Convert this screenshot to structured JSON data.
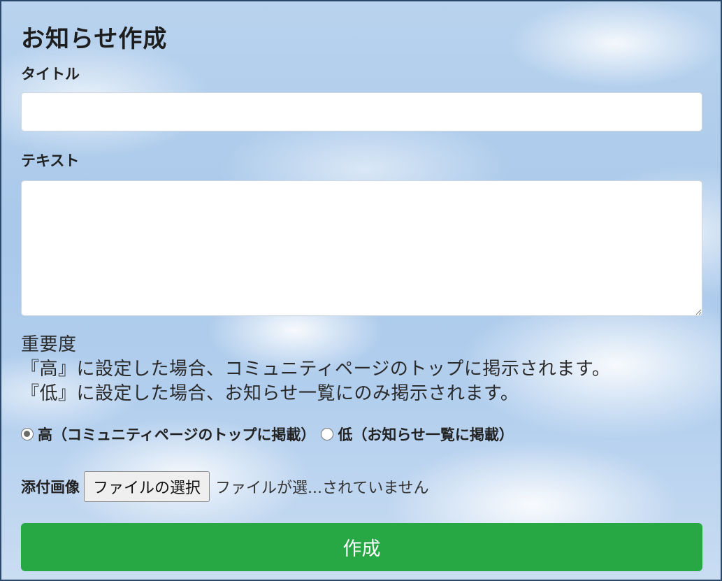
{
  "page": {
    "title": "お知らせ作成"
  },
  "form": {
    "title_label": "タイトル",
    "title_value": "",
    "text_label": "テキスト",
    "text_value": "",
    "importance": {
      "heading": "重要度",
      "description_high": "『高』に設定した場合、コミュニティページのトップに掲示されます。",
      "description_low": "『低』に設定した場合、お知らせ一覧にのみ掲示されます。",
      "options": [
        {
          "label": "高（コミュニティページのトップに掲載）",
          "selected": true
        },
        {
          "label": "低（お知らせ一覧に掲載）",
          "selected": false
        }
      ]
    },
    "attachment": {
      "label": "添付画像",
      "button_label": "ファイルの選択",
      "status_text": "ファイルが選...されていません"
    },
    "submit_label": "作成"
  },
  "colors": {
    "submit_background": "#28a745",
    "frame_border": "#2b4a6b"
  }
}
